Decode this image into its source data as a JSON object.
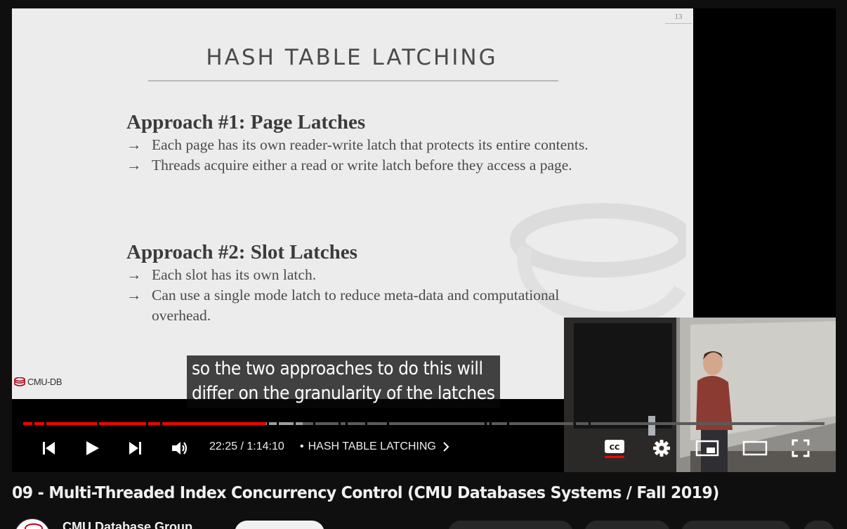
{
  "slide": {
    "number": "13",
    "title": "HASH TABLE LATCHING",
    "sections": [
      {
        "heading": "Approach #1: Page Latches",
        "bullets": [
          "Each page has its own reader-write latch that protects its entire contents.",
          "Threads acquire either a read or write latch before they access a page."
        ]
      },
      {
        "heading": "Approach #2: Slot Latches",
        "bullets": [
          "Each slot has its own latch.",
          "Can use a single mode latch to reduce meta-data and computational overhead."
        ]
      }
    ],
    "bullet_arrow": "→",
    "logo_text": "CMU-DB"
  },
  "caption": {
    "line1": "so the two approaches to do this will",
    "line2": "differ on the granularity of the latches"
  },
  "player": {
    "current_time": "22:25",
    "duration": "1:14:10",
    "time_display": "22:25 / 1:14:10",
    "chapter_separator": "•",
    "chapter_title": "HASH TABLE LATCHING",
    "progress_fraction": 0.303,
    "buffered_fraction": 0.349,
    "colors": {
      "played": "#f00",
      "buffered": "#9e9e9e",
      "unplayed": "#5a5a5a",
      "cc_underline": "#f00"
    },
    "icons": [
      "previous-icon",
      "play-icon",
      "next-icon",
      "volume-icon",
      "chevron-right-icon",
      "captions-icon",
      "settings-icon",
      "miniplayer-icon",
      "theater-mode-icon",
      "fullscreen-icon"
    ]
  },
  "video": {
    "title": "09 - Multi-Threaded Index Concurrency Control (CMU Databases Systems / Fall 2019)",
    "channel_name": "CMU Database Group"
  }
}
